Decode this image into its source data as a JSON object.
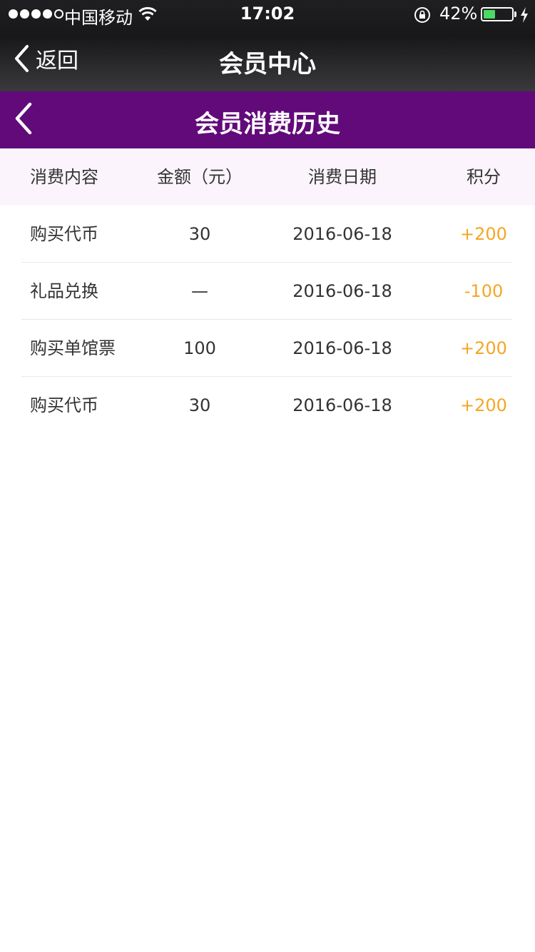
{
  "status_bar": {
    "carrier": "中国移动",
    "time": "17:02",
    "battery_percent": "42%",
    "battery_level": 0.42,
    "signal_bars": 4,
    "signal_total": 5
  },
  "nav": {
    "back_label": "返回",
    "title": "会员中心"
  },
  "header": {
    "title": "会员消费历史",
    "background": "#620a7a"
  },
  "table": {
    "columns": [
      "消费内容",
      "金额（元）",
      "消费日期",
      "积分"
    ],
    "rows": [
      {
        "item": "购买代币",
        "amount": "30",
        "date": "2016-06-18",
        "points": "+200"
      },
      {
        "item": "礼品兑换",
        "amount": "—",
        "date": "2016-06-18",
        "points": "-100"
      },
      {
        "item": "购买单馆票",
        "amount": "100",
        "date": "2016-06-18",
        "points": "+200"
      },
      {
        "item": "购买代币",
        "amount": "30",
        "date": "2016-06-18",
        "points": "+200"
      }
    ],
    "points_color": "#f5a623"
  }
}
